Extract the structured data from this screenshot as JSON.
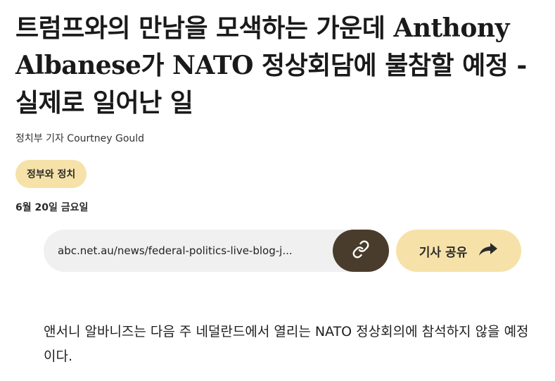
{
  "article": {
    "headline": "트럼프와의 만남을 모색하는 가운데 Anthony Albanese가 NATO 정상회담에 불참할 예정 - 실제로 일어난 일",
    "byline": "정치부 기자 Courtney Gould",
    "tag": "정부와 정치",
    "date": "6월 20일 금요일",
    "share": {
      "url": "abc.net.au/news/federal-politics-live-blog-j...",
      "copy_icon": "link-icon",
      "share_label": "기사 공유",
      "share_icon": "share-arrow-icon"
    },
    "body": "앤서니 알바니즈는 다음 주 네덜란드에서 열리는 NATO 정상회의에 참석하지 않을 예정이다."
  },
  "colors": {
    "accent_yellow": "#f6e2a8",
    "copy_button": "#4a3c2c",
    "url_background": "#f0f0f0"
  }
}
